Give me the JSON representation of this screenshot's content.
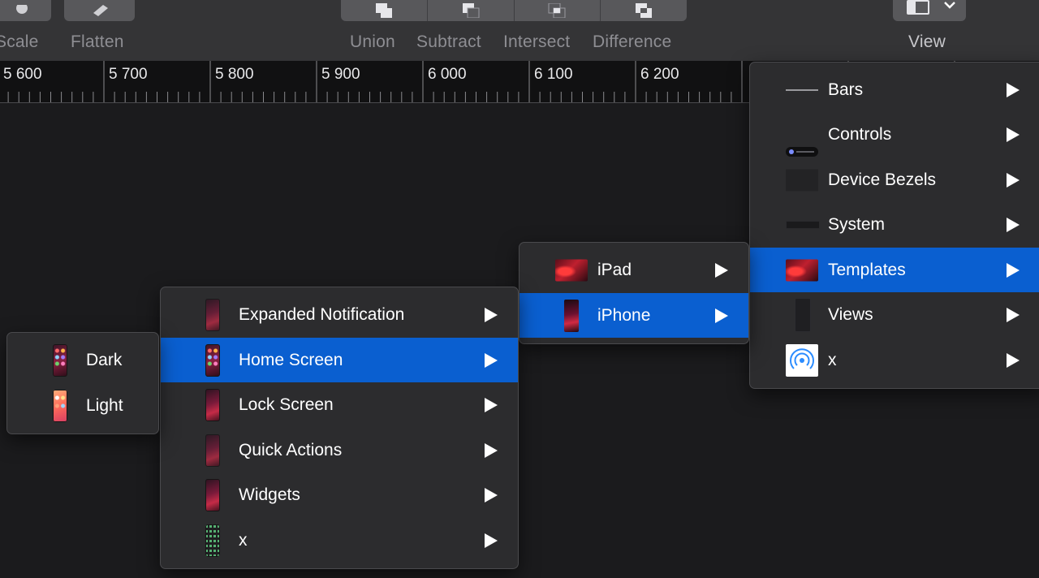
{
  "toolbar": {
    "items": {
      "scale": "Scale",
      "flatten": "Flatten",
      "union": "Union",
      "subtract": "Subtract",
      "intersect": "Intersect",
      "difference": "Difference",
      "view": "View"
    }
  },
  "ruler": {
    "labels": [
      "5 600",
      "5 700",
      "5 800",
      "5 900",
      "6 000",
      "6 100",
      "6 200"
    ]
  },
  "menus": {
    "variant": {
      "items": [
        {
          "label": "Dark",
          "thumb": "phone-home-dark-icon"
        },
        {
          "label": "Light",
          "thumb": "phone-home-light-icon"
        }
      ]
    },
    "iphone_templates": {
      "items": [
        {
          "label": "Expanded Notification",
          "thumb": "phone-thumb-icon",
          "selected": false
        },
        {
          "label": "Home Screen",
          "thumb": "phone-home-icon",
          "selected": true
        },
        {
          "label": "Lock Screen",
          "thumb": "phone-thumb-icon",
          "selected": false
        },
        {
          "label": "Quick Actions",
          "thumb": "phone-thumb-icon",
          "selected": false
        },
        {
          "label": "Widgets",
          "thumb": "phone-thumb-icon",
          "selected": false
        },
        {
          "label": "x",
          "thumb": "phone-grid-icon",
          "selected": false
        }
      ]
    },
    "devices": {
      "items": [
        {
          "label": "iPad",
          "thumb": "ipad-thumb-icon",
          "selected": false
        },
        {
          "label": "iPhone",
          "thumb": "iphone-thumb-icon",
          "selected": true
        }
      ]
    },
    "library": {
      "items": [
        {
          "label": "Bars",
          "thumb": "bars-thumb-icon",
          "selected": false
        },
        {
          "label": "Controls",
          "thumb": "controls-thumb-icon",
          "selected": false
        },
        {
          "label": "Device Bezels",
          "thumb": "bezel-thumb-icon",
          "selected": false
        },
        {
          "label": "System",
          "thumb": "system-thumb-icon",
          "selected": false
        },
        {
          "label": "Templates",
          "thumb": "templates-thumb-icon",
          "selected": true
        },
        {
          "label": "Views",
          "thumb": "views-thumb-icon",
          "selected": false
        },
        {
          "label": "x",
          "thumb": "airdrop-icon",
          "selected": false
        }
      ]
    }
  },
  "colors": {
    "selection": "#0a5fd0",
    "menu_bg": "#2c2c2e",
    "toolbar_bg": "#343436",
    "canvas_bg": "#1b1b1d"
  }
}
